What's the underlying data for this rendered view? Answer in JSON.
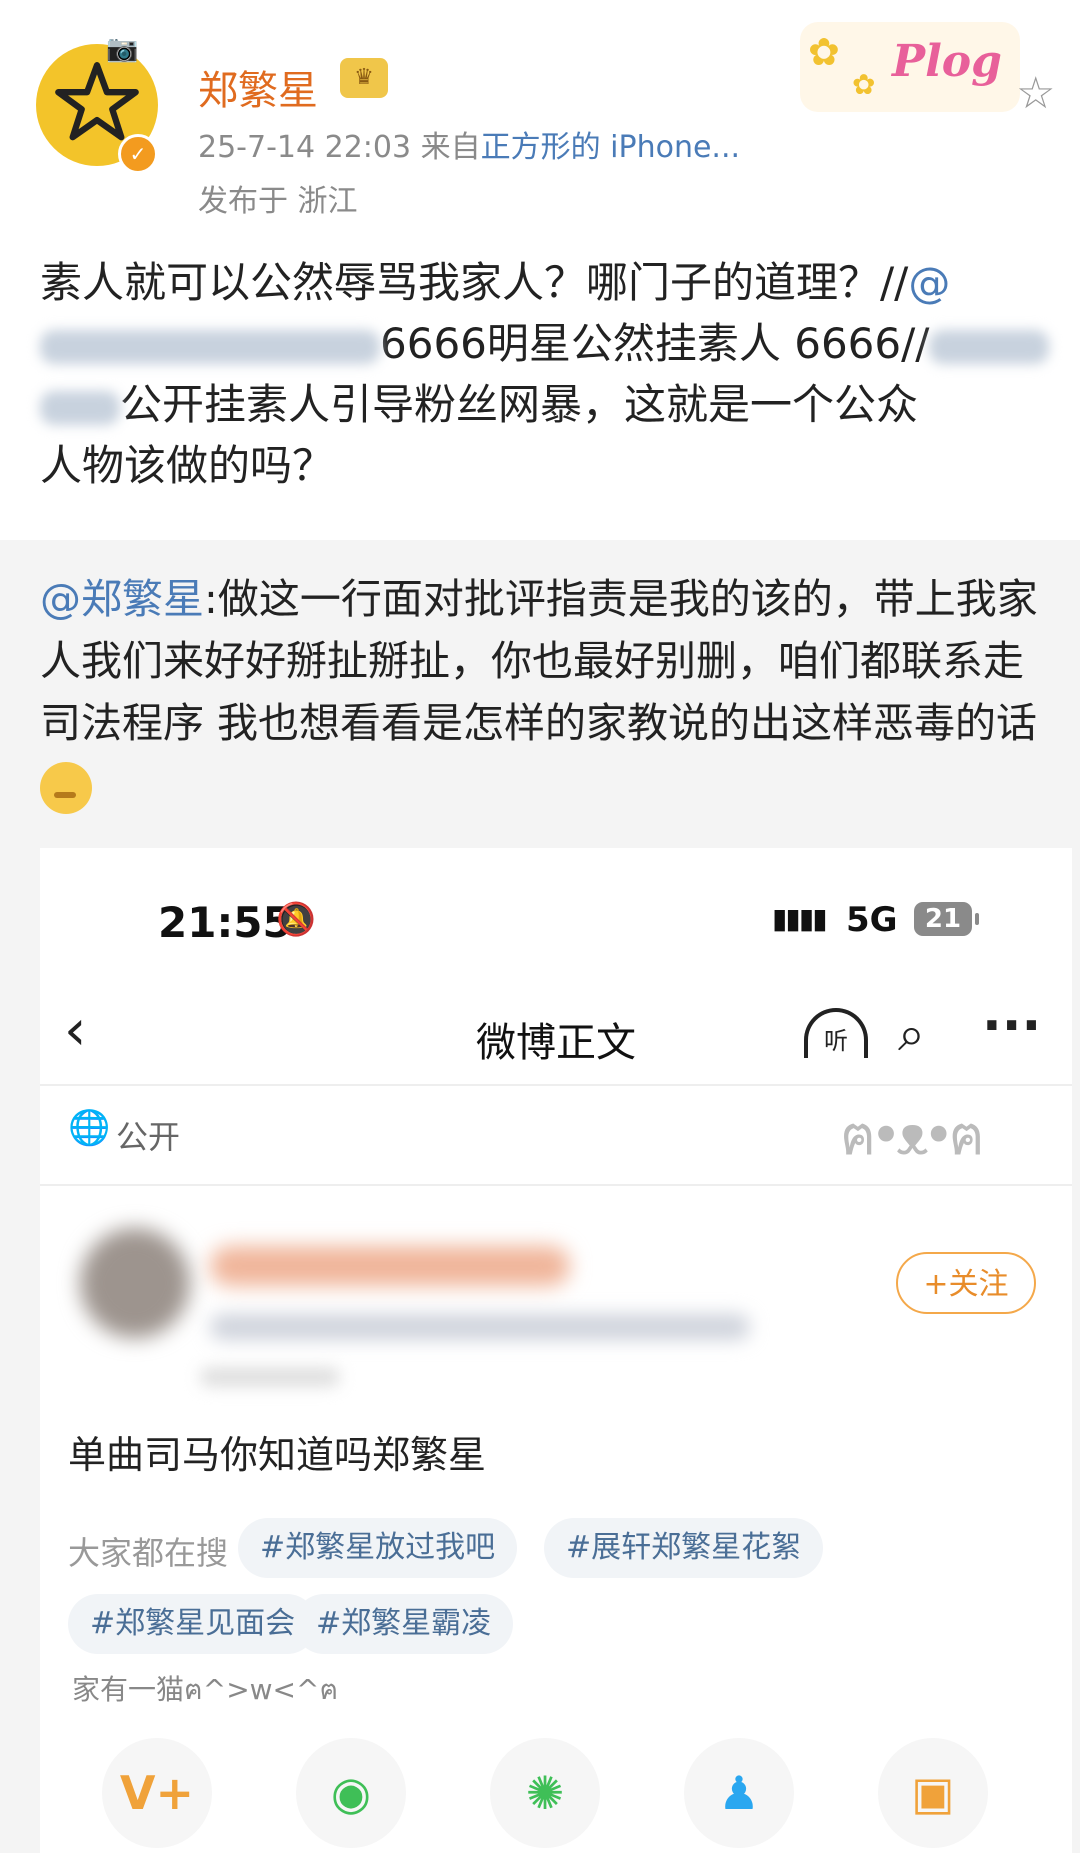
{
  "header": {
    "username": "郑繁星",
    "crown_badge": "♛",
    "verified_badge": "✓",
    "timestamp": "25-7-14 22:03",
    "source_prefix": "来自",
    "source_device": "正方形的 iPhone...",
    "location": "发布于 浙江",
    "sticker_text": "Plog",
    "star_icon": "star-icon"
  },
  "post": {
    "line1": "素人就可以公然辱骂我家人？哪门子的道理？//",
    "at1": "@",
    "line2_visible": "6666明星公然挂素人 6666//",
    "line3_visible": "公开挂素人引导粉丝网暴，这就是一个公众",
    "line4": "人物该做的吗？"
  },
  "repost": {
    "mention": "@郑繁星",
    "text": ":做这一行面对批评指责是我的该的，带上我家人我们来好好掰扯掰扯，你也最好别删，咱们都联系走司法程序 我也想看看是怎样的家教说的出这样恶毒的话"
  },
  "screenshot": {
    "status_bar": {
      "time": "21:55",
      "network": "5G",
      "battery": "21"
    },
    "nav": {
      "title": "微博正文",
      "listen_label": "听"
    },
    "visibility": "公开",
    "follow_button": "+关注",
    "post_text": "单曲司马你知道吗郑繁星",
    "hot_search_label": "大家都在搜",
    "hot_tags": [
      "#郑繁星放过我吧",
      "#展轩郑繁星花絮",
      "#郑繁星见面会",
      "#郑繁星霸凌"
    ],
    "cat_caption": "家有一猫ฅ^>w<^ฅ",
    "share_buttons": [
      {
        "name": "weibo-vplus",
        "glyph": "V+",
        "color": "#f0a23a"
      },
      {
        "name": "wechat",
        "glyph": "◉",
        "color": "#3fbf57"
      },
      {
        "name": "moments",
        "glyph": "✺",
        "color": "#3fbf57"
      },
      {
        "name": "qq",
        "glyph": "♟",
        "color": "#2aa7f0"
      },
      {
        "name": "save-image",
        "glyph": "▣",
        "color": "#f0a23a"
      }
    ]
  }
}
